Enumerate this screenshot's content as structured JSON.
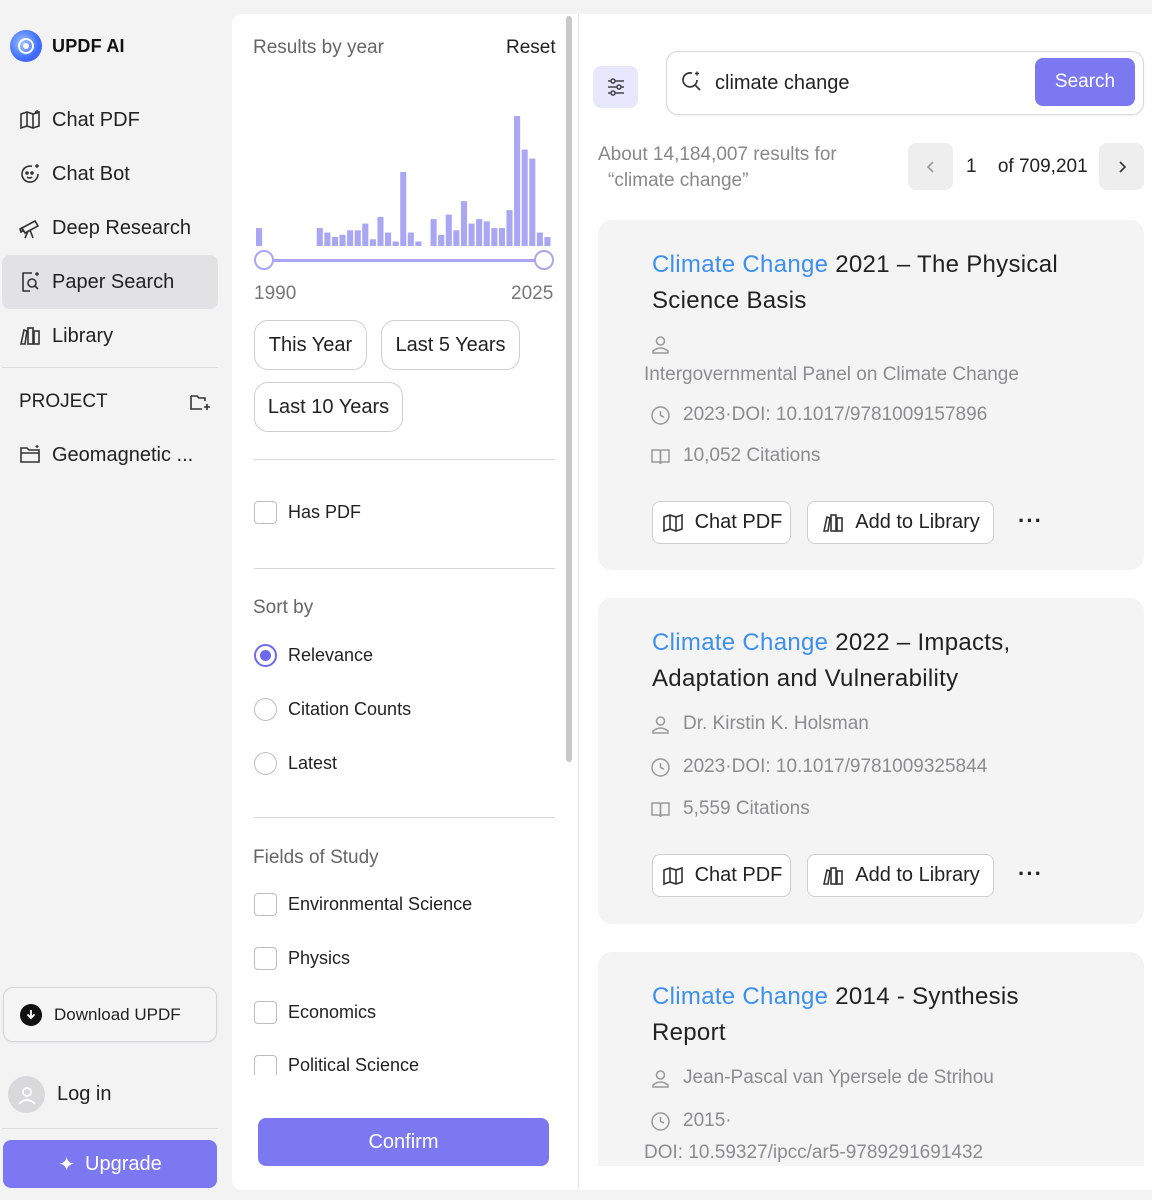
{
  "brand": {
    "name": "UPDF AI"
  },
  "sidebar": {
    "items": [
      {
        "label": "Chat PDF",
        "icon": "chat-pdf-icon",
        "active": false
      },
      {
        "label": "Chat Bot",
        "icon": "chat-bot-icon",
        "active": false
      },
      {
        "label": "Deep Research",
        "icon": "telescope-icon",
        "active": false
      },
      {
        "label": "Paper Search",
        "icon": "paper-search-icon",
        "active": true
      },
      {
        "label": "Library",
        "icon": "library-icon",
        "active": false
      }
    ],
    "project_label": "PROJECT",
    "project_item": "Geomagnetic ...",
    "download_label": "Download UPDF",
    "login_label": "Log in",
    "upgrade_label": "Upgrade"
  },
  "filter": {
    "results_by_year": "Results by year",
    "reset": "Reset",
    "year_min": "1990",
    "year_max": "2025",
    "histogram_values": [
      8,
      0,
      0,
      0,
      0,
      0,
      0,
      0,
      8,
      6,
      4,
      5,
      7,
      7,
      10,
      3,
      13,
      6,
      2,
      33,
      6,
      2,
      0,
      12,
      5,
      14,
      7,
      20,
      10,
      12,
      11,
      8,
      8,
      16,
      58,
      43,
      39,
      6,
      4
    ],
    "chips": [
      "This Year",
      "Last 5 Years",
      "Last 10 Years"
    ],
    "has_pdf": "Has PDF",
    "sort_by": "Sort by",
    "sort_options": [
      {
        "label": "Relevance",
        "selected": true
      },
      {
        "label": "Citation Counts",
        "selected": false
      },
      {
        "label": "Latest",
        "selected": false
      }
    ],
    "fields_title": "Fields of Study",
    "fields": [
      "Environmental Science",
      "Physics",
      "Economics",
      "Political Science"
    ],
    "confirm": "Confirm"
  },
  "search": {
    "query": "climate change",
    "button": "Search",
    "results_count_line1": "About 14,184,007 results for",
    "results_count_line2": "“climate change”",
    "page_current": "1",
    "page_total": "of 709,201"
  },
  "results": [
    {
      "title_highlight": "Climate Change",
      "title_line1_rest": " 2021 – The Physical",
      "title_line2": "Science Basis",
      "author": "Intergovernmental Panel on Climate Change",
      "doi": "2023·DOI: 10.1017/9781009157896",
      "citations": "10,052 Citations",
      "chat_pdf": "Chat PDF",
      "add_library": "Add to Library",
      "more": "···"
    },
    {
      "title_highlight": "Climate Change",
      "title_line1_rest": " 2022 – Impacts,",
      "title_line2": "Adaptation and Vulnerability",
      "author": "Dr. Kirstin K. Holsman",
      "doi": "2023·DOI: 10.1017/9781009325844",
      "citations": "5,559 Citations",
      "chat_pdf": "Chat PDF",
      "add_library": "Add to Library",
      "more": "···"
    },
    {
      "title_highlight": "Climate Change",
      "title_line1_rest": " 2014 - Synthesis",
      "title_line2": "Report",
      "author": "Jean-Pascal van Ypersele de Strihou",
      "doi_year": "2015·",
      "doi": "DOI: 10.59327/ipcc/ar5-9789291691432"
    }
  ],
  "colors": {
    "accent": "#7b78f2",
    "highlight": "#3d8ff0"
  }
}
